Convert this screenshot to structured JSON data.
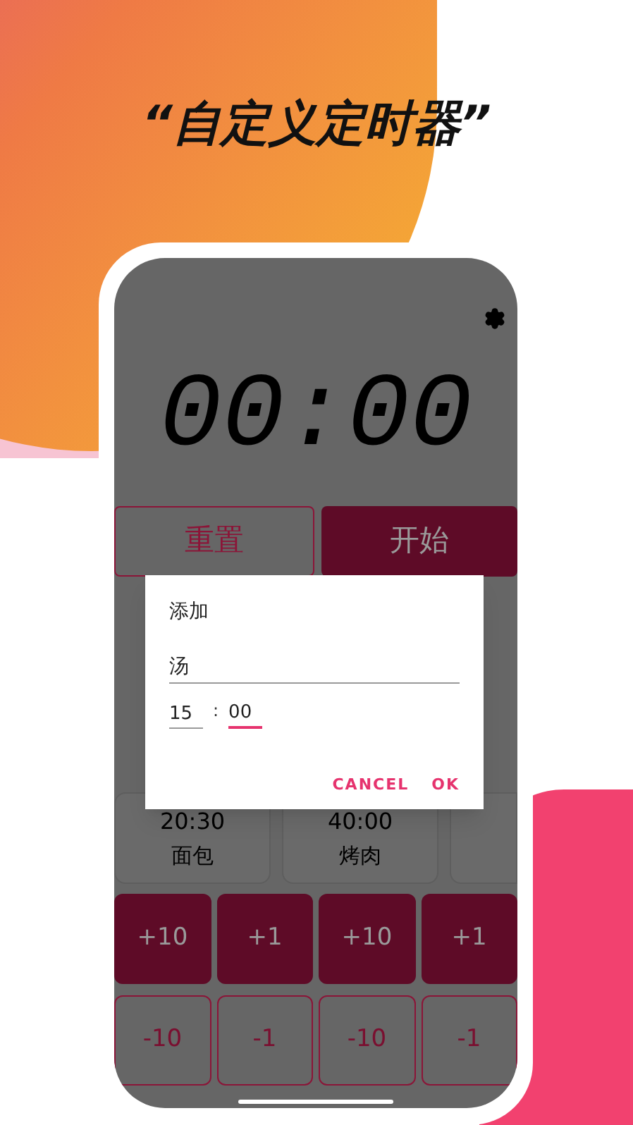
{
  "headline": "“自定义定时器”",
  "timer": {
    "display": "00:00"
  },
  "controls": [
    {
      "label": "重置",
      "kind": "outline"
    },
    {
      "label": "开始",
      "kind": "filled"
    }
  ],
  "dialog": {
    "title": "添加",
    "name_value": "汤",
    "separator": ":",
    "time_fields": [
      {
        "value": "15",
        "focused": false
      },
      {
        "value": "00",
        "focused": true
      }
    ],
    "buttons": [
      "CANCEL",
      "OK"
    ]
  },
  "presets": [
    {
      "kind": "preset",
      "time": "20:30",
      "name": "面包"
    },
    {
      "kind": "preset",
      "time": "40:00",
      "name": "烤肉"
    },
    {
      "kind": "partial"
    }
  ],
  "increment_buttons": [
    "+10",
    "+1",
    "+10",
    "+1"
  ],
  "decrement_buttons": [
    "-10",
    "-1",
    "-10",
    "-1"
  ]
}
